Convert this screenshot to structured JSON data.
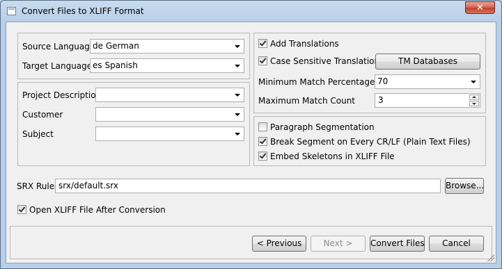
{
  "window": {
    "title": "Convert Files to XLIFF Format",
    "close_label": "✕"
  },
  "languages": {
    "source_label": "Source Language",
    "source_value": "de German",
    "target_label": "Target Language",
    "target_value": "es Spanish"
  },
  "project": {
    "description_label": "Project Description",
    "description_value": "",
    "customer_label": "Customer",
    "customer_value": "",
    "subject_label": "Subject",
    "subject_value": ""
  },
  "translations": {
    "add_label": "Add Translations",
    "add_checked": true,
    "case_label": "Case Sensitive Translations",
    "case_checked": true,
    "tm_button": "TM Databases",
    "min_match_label": "Minimum Match Percentage",
    "min_match_value": "70",
    "max_count_label": "Maximum Match Count",
    "max_count_value": "3"
  },
  "segmentation": {
    "paragraph_label": "Paragraph Segmentation",
    "paragraph_checked": false,
    "break_label": "Break Segment on Every CR/LF (Plain Text Files)",
    "break_checked": true,
    "embed_label": "Embed Skeletons in XLIFF File",
    "embed_checked": true
  },
  "srx": {
    "label": "SRX Rules",
    "value": "srx/default.srx",
    "browse": "Browse..."
  },
  "open_after": {
    "label": "Open XLIFF File After Conversion",
    "checked": true
  },
  "footer": {
    "previous": "< Previous",
    "next": "Next >",
    "convert": "Convert Files",
    "cancel": "Cancel"
  }
}
